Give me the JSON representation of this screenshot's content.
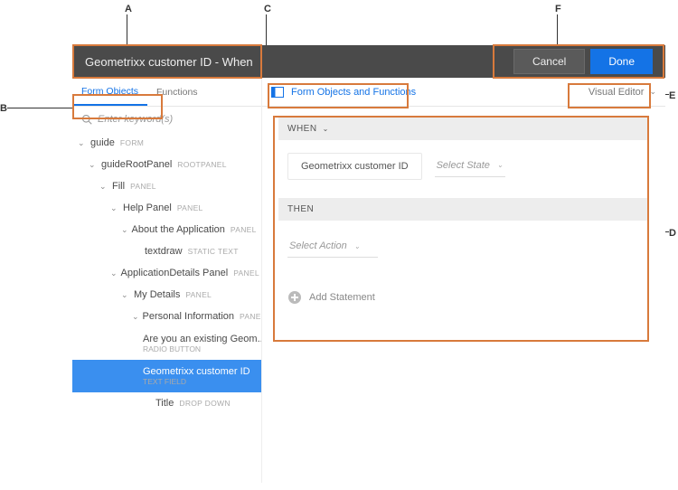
{
  "callouts": {
    "a": "A",
    "b": "B",
    "c": "C",
    "d": "D",
    "e": "E",
    "f": "F"
  },
  "header": {
    "title": "Geometrixx customer ID - When",
    "cancel": "Cancel",
    "done": "Done"
  },
  "sidebar": {
    "tabs": {
      "formObjects": "Form Objects",
      "functions": "Functions"
    },
    "searchPlaceholder": "Enter keyword(s)",
    "tree": [
      {
        "indent": 0,
        "open": true,
        "label": "guide",
        "type": "FORM"
      },
      {
        "indent": 1,
        "open": true,
        "label": "guideRootPanel",
        "type": "ROOTPANEL"
      },
      {
        "indent": 2,
        "open": true,
        "label": "Fill",
        "type": "PANEL"
      },
      {
        "indent": 3,
        "open": true,
        "label": "Help Panel",
        "type": "PANEL"
      },
      {
        "indent": 4,
        "open": true,
        "label": "About the Application",
        "type": "PANEL"
      },
      {
        "indent": 5,
        "open": false,
        "label": "textdraw",
        "type": "STATIC TEXT"
      },
      {
        "indent": 3,
        "open": true,
        "label": "ApplicationDetails Panel",
        "type": "PANEL"
      },
      {
        "indent": 4,
        "open": true,
        "label": "My Details",
        "type": "PANEL"
      },
      {
        "indent": 5,
        "open": true,
        "label": "Personal Information",
        "type": "PANEL"
      },
      {
        "indent": 6,
        "open": false,
        "label": "Are you an existing Geom...",
        "type": "RADIO BUTTON",
        "subline": true
      },
      {
        "indent": 6,
        "open": false,
        "label": "Geometrixx customer ID",
        "type": "TEXT FIELD",
        "selected": true,
        "subline": true
      },
      {
        "indent": 6,
        "open": false,
        "label": "Title",
        "type": "DROP DOWN"
      }
    ]
  },
  "toolbar": {
    "leftLabel": "Form Objects and Functions",
    "editorMode": "Visual Editor"
  },
  "rule": {
    "whenLabel": "WHEN",
    "whenObject": "Geometrixx customer ID",
    "stateDropdown": "Select State",
    "thenLabel": "THEN",
    "actionDropdown": "Select Action",
    "addStatement": "Add Statement"
  }
}
